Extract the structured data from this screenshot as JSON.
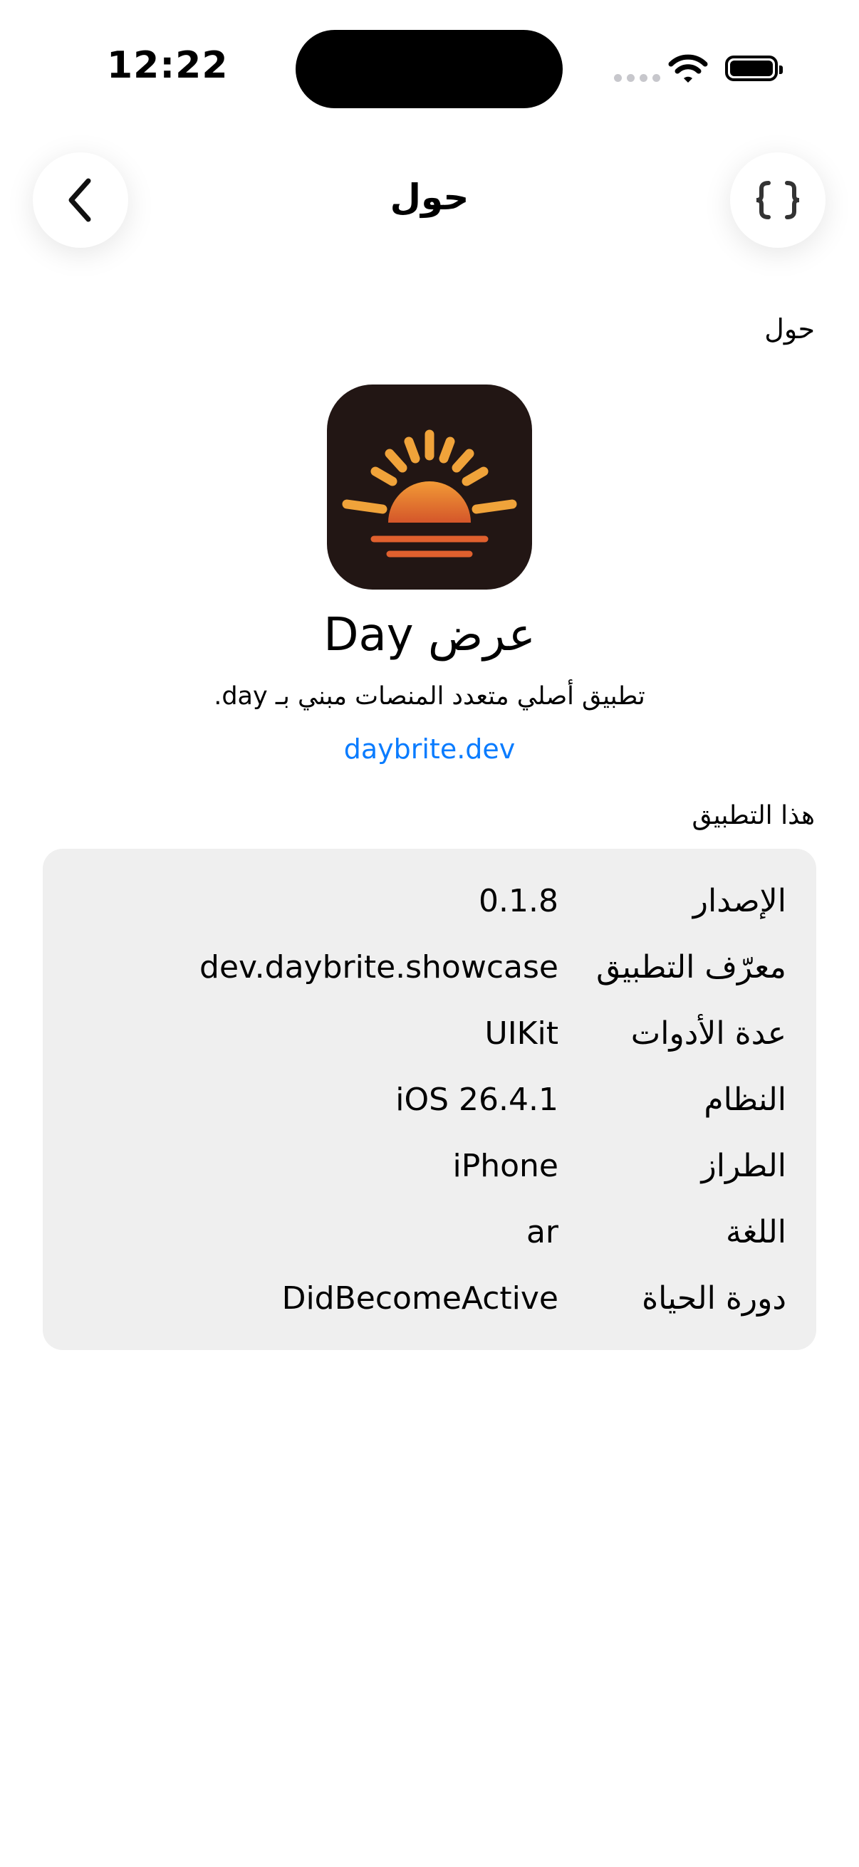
{
  "status_bar": {
    "time": "12:22"
  },
  "nav": {
    "title": "حول",
    "back_icon": "chevron-left-icon",
    "code_icon": "curly-braces-icon"
  },
  "header_section": "حول",
  "app": {
    "icon": "sunrise-app-icon",
    "name": "عرض Day",
    "tagline": "تطبيق أصلي متعدد المنصات مبني بـ day.",
    "website": "daybrite.dev"
  },
  "info_section_title": "هذا التطبيق",
  "info_rows": [
    {
      "label": "الإصدار",
      "value": "0.1.8"
    },
    {
      "label": "معرّف التطبيق",
      "value": "dev.daybrite.showcase"
    },
    {
      "label": "عدة الأدوات",
      "value": "UIKit"
    },
    {
      "label": "النظام",
      "value": "iOS 26.4.1"
    },
    {
      "label": "الطراز",
      "value": "iPhone"
    },
    {
      "label": "اللغة",
      "value": "ar"
    },
    {
      "label": "دورة الحياة",
      "value": "DidBecomeActive"
    }
  ],
  "colors": {
    "link": "#0a7cff",
    "card": "#efefef",
    "icon_bg": "#221614",
    "sun": "#f0a33a"
  }
}
